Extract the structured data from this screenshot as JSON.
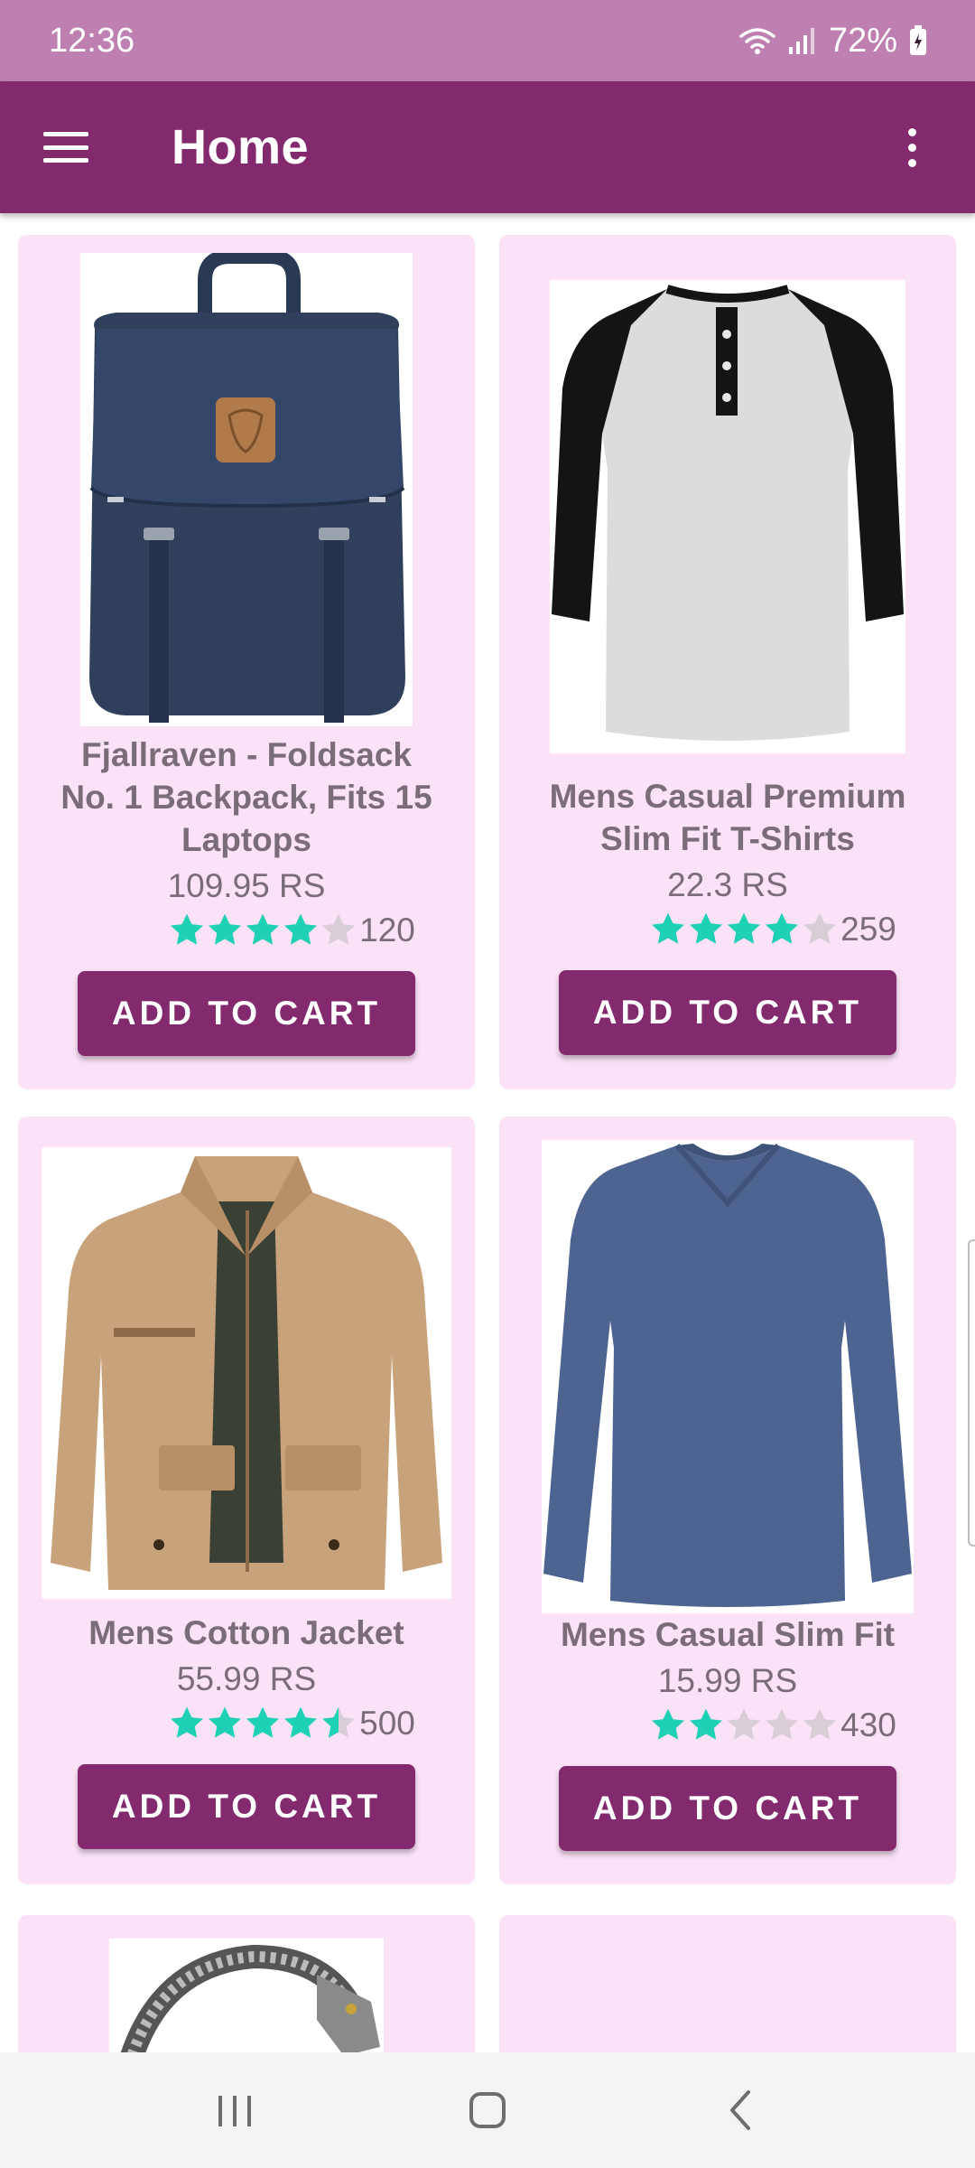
{
  "status_bar": {
    "time": "12:36",
    "battery": "72%",
    "icons": [
      "wifi-icon",
      "signal-icon",
      "battery-charging-icon"
    ]
  },
  "app_bar": {
    "title": "Home",
    "menu_icon": "hamburger-menu-icon",
    "overflow_icon": "more-vert-icon"
  },
  "colors": {
    "primary": "#832a6f",
    "status_bar": "#bd80b0",
    "card_bg": "#fbe2f7",
    "text": "#7a6d78",
    "star_filled": "#1fd1b4",
    "star_empty": "#d9cdd6"
  },
  "products": [
    {
      "title": "Fjallraven - Foldsack No. 1 Backpack, Fits 15 Laptops",
      "price": "109.95 RS",
      "rating": 4,
      "rating_count": "120",
      "button": "ADD TO CART",
      "image": "backpack-image"
    },
    {
      "title": "Mens Casual Premium Slim Fit T-Shirts",
      "price": "22.3 RS",
      "rating": 4,
      "rating_count": "259",
      "button": "ADD TO CART",
      "image": "raglan-tshirt-image"
    },
    {
      "title": "Mens Cotton Jacket",
      "price": "55.99 RS",
      "rating": 4.5,
      "rating_count": "500",
      "button": "ADD TO CART",
      "image": "cotton-jacket-image"
    },
    {
      "title": "Mens Casual Slim Fit",
      "price": "15.99 RS",
      "rating": 2,
      "rating_count": "430",
      "button": "ADD TO CART",
      "image": "long-sleeve-tshirt-image"
    }
  ],
  "nav_bar": {
    "icons": [
      "recents-icon",
      "home-icon",
      "back-icon"
    ]
  }
}
